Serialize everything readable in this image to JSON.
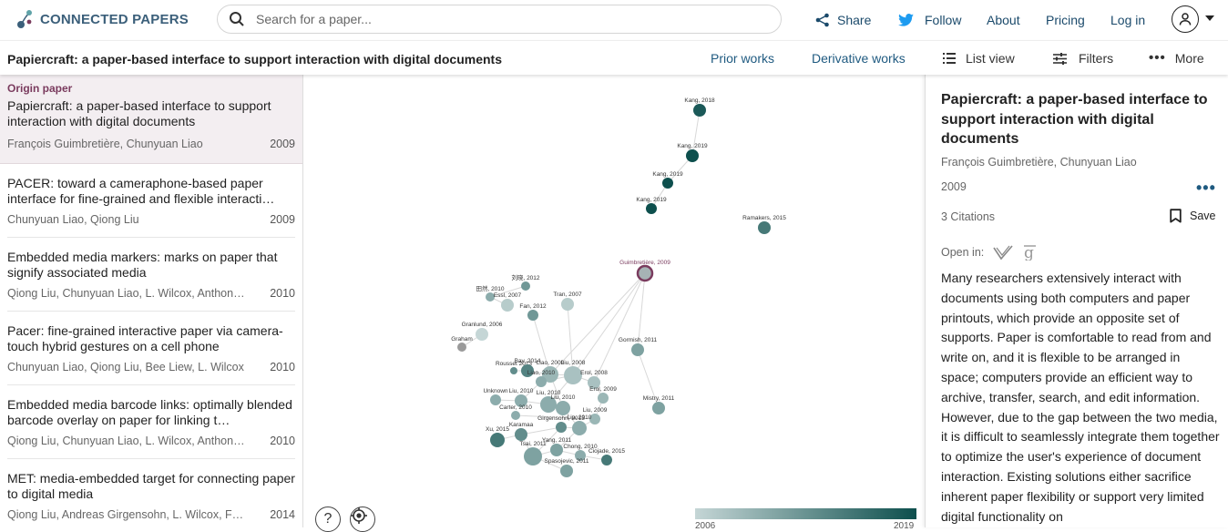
{
  "header": {
    "brand": "CONNECTED PAPERS",
    "search_placeholder": "Search for a paper...",
    "nav": {
      "share": "Share",
      "follow": "Follow",
      "about": "About",
      "pricing": "Pricing",
      "login": "Log in"
    }
  },
  "toolbar": {
    "paper_title": "Papiercraft: a paper-based interface to support interaction with digital documents",
    "prior_works": "Prior works",
    "derivative_works": "Derivative works",
    "list_view": "List view",
    "filters": "Filters",
    "more": "More"
  },
  "origin": {
    "label": "Origin paper",
    "title": "Papiercraft: a paper-based interface to support interaction with digital documents",
    "authors": "François Guimbretière, Chunyuan Liao",
    "year": "2009"
  },
  "papers": [
    {
      "title": "PACER: toward a cameraphone-based paper interface for fine-grained and flexible interacti…",
      "authors": "Chunyuan Liao, Qiong Liu",
      "year": "2009"
    },
    {
      "title": "Embedded media markers: marks on paper that signify associated media",
      "authors": "Qiong Liu, Chunyuan Liao, L. Wilcox, Anthony…",
      "year": "2010"
    },
    {
      "title": "Pacer: fine-grained interactive paper via camera-touch hybrid gestures on a cell phone",
      "authors": "Chunyuan Liao, Qiong Liu, Bee Liew, L. Wilcox",
      "year": "2010"
    },
    {
      "title": "Embedded media barcode links: optimally blended barcode overlay on paper for linking t…",
      "authors": "Qiong Liu, Chunyuan Liao, L. Wilcox, Anthony…",
      "year": "2010"
    },
    {
      "title": "MET: media-embedded target for connecting paper to digital media",
      "authors": "Qiong Liu, Andreas Girgensohn, L. Wilcox, F…",
      "year": "2014"
    }
  ],
  "graph": {
    "nodes": [
      {
        "label": "Kang, 2018",
        "year": 2018
      },
      {
        "label": "Kang, 2019",
        "year": 2019
      },
      {
        "label": "Kang, 2019",
        "year": 2019
      },
      {
        "label": "Kang, 2019",
        "year": 2019
      },
      {
        "label": "Ramakers, 2015",
        "year": 2015
      },
      {
        "label": "Guimbretière, 2009",
        "year": 2009,
        "origin": true
      },
      {
        "label": "刘晓, 2012",
        "year": 2012
      },
      {
        "label": "田然, 2010",
        "year": 2010
      },
      {
        "label": "Essl, 2007",
        "year": 2007
      },
      {
        "label": "Tran, 2007",
        "year": 2007
      },
      {
        "label": "Fan, 2012",
        "year": 2012
      },
      {
        "label": "Granlund, 2006",
        "year": 2006
      },
      {
        "label": "Graham",
        "year": 2008
      },
      {
        "label": "Gormish, 2011",
        "year": 2011
      },
      {
        "label": "Rousset 2013",
        "year": 2013
      },
      {
        "label": "Bay, 2014",
        "year": 2014
      },
      {
        "label": "Liao, 2009",
        "year": 2009
      },
      {
        "label": "Liao, 2010",
        "year": 2010
      },
      {
        "label": "Liu, 2008",
        "year": 2008
      },
      {
        "label": "Erol, 2008",
        "year": 2008
      },
      {
        "label": "Erol, 2009",
        "year": 2009
      },
      {
        "label": "Unknown",
        "year": 2010
      },
      {
        "label": "Liu, 2010",
        "year": 2010
      },
      {
        "label": "Liu, 2010",
        "year": 2010
      },
      {
        "label": "Carter, 2010",
        "year": 2010
      },
      {
        "label": "Liu, 2010",
        "year": 2010
      },
      {
        "label": "Liu, 2009",
        "year": 2009
      },
      {
        "label": "Mistry, 2011",
        "year": 2011
      },
      {
        "label": "Liu, 2010",
        "year": 2010
      },
      {
        "label": "Girgensohn, 2013",
        "year": 2013
      },
      {
        "label": "Karamaa",
        "year": 2013
      },
      {
        "label": "Xu, 2015",
        "year": 2015
      },
      {
        "label": "Yang, 2011",
        "year": 2011
      },
      {
        "label": "Chong, 2010",
        "year": 2010
      },
      {
        "label": "Tsai, 2011",
        "year": 2011
      },
      {
        "label": "Ciojade, 2015",
        "year": 2015
      },
      {
        "label": "Spasojevic, 2011",
        "year": 2011
      }
    ],
    "legend_min": "2006",
    "legend_max": "2019",
    "help_label": "?"
  },
  "detail": {
    "title": "Papiercraft: a paper-based interface to support interaction with digital documents",
    "authors": "François Guimbretière, Chunyuan Liao",
    "year": "2009",
    "citations": "3 Citations",
    "save": "Save",
    "open_in": "Open in:",
    "abstract": "Many researchers extensively interact with documents using both computers and paper printouts, which provide an opposite set of supports. Paper is comfortable to read from and write on, and it is flexible to be arranged in space; computers provide an efficient way to archive, transfer, search, and edit information. However, due to the gap between the two media, it is difficult to seamlessly integrate them together to optimize the user's experience of document interaction. Existing solutions either sacrifice inherent paper flexibility or support very limited digital functionality on"
  },
  "colors": {
    "brand": "#3b5f7a",
    "link": "#1f5a80",
    "origin_accent": "#7a3b5e",
    "node_old": "#c5d6d6",
    "node_new": "#0d4f4d"
  }
}
